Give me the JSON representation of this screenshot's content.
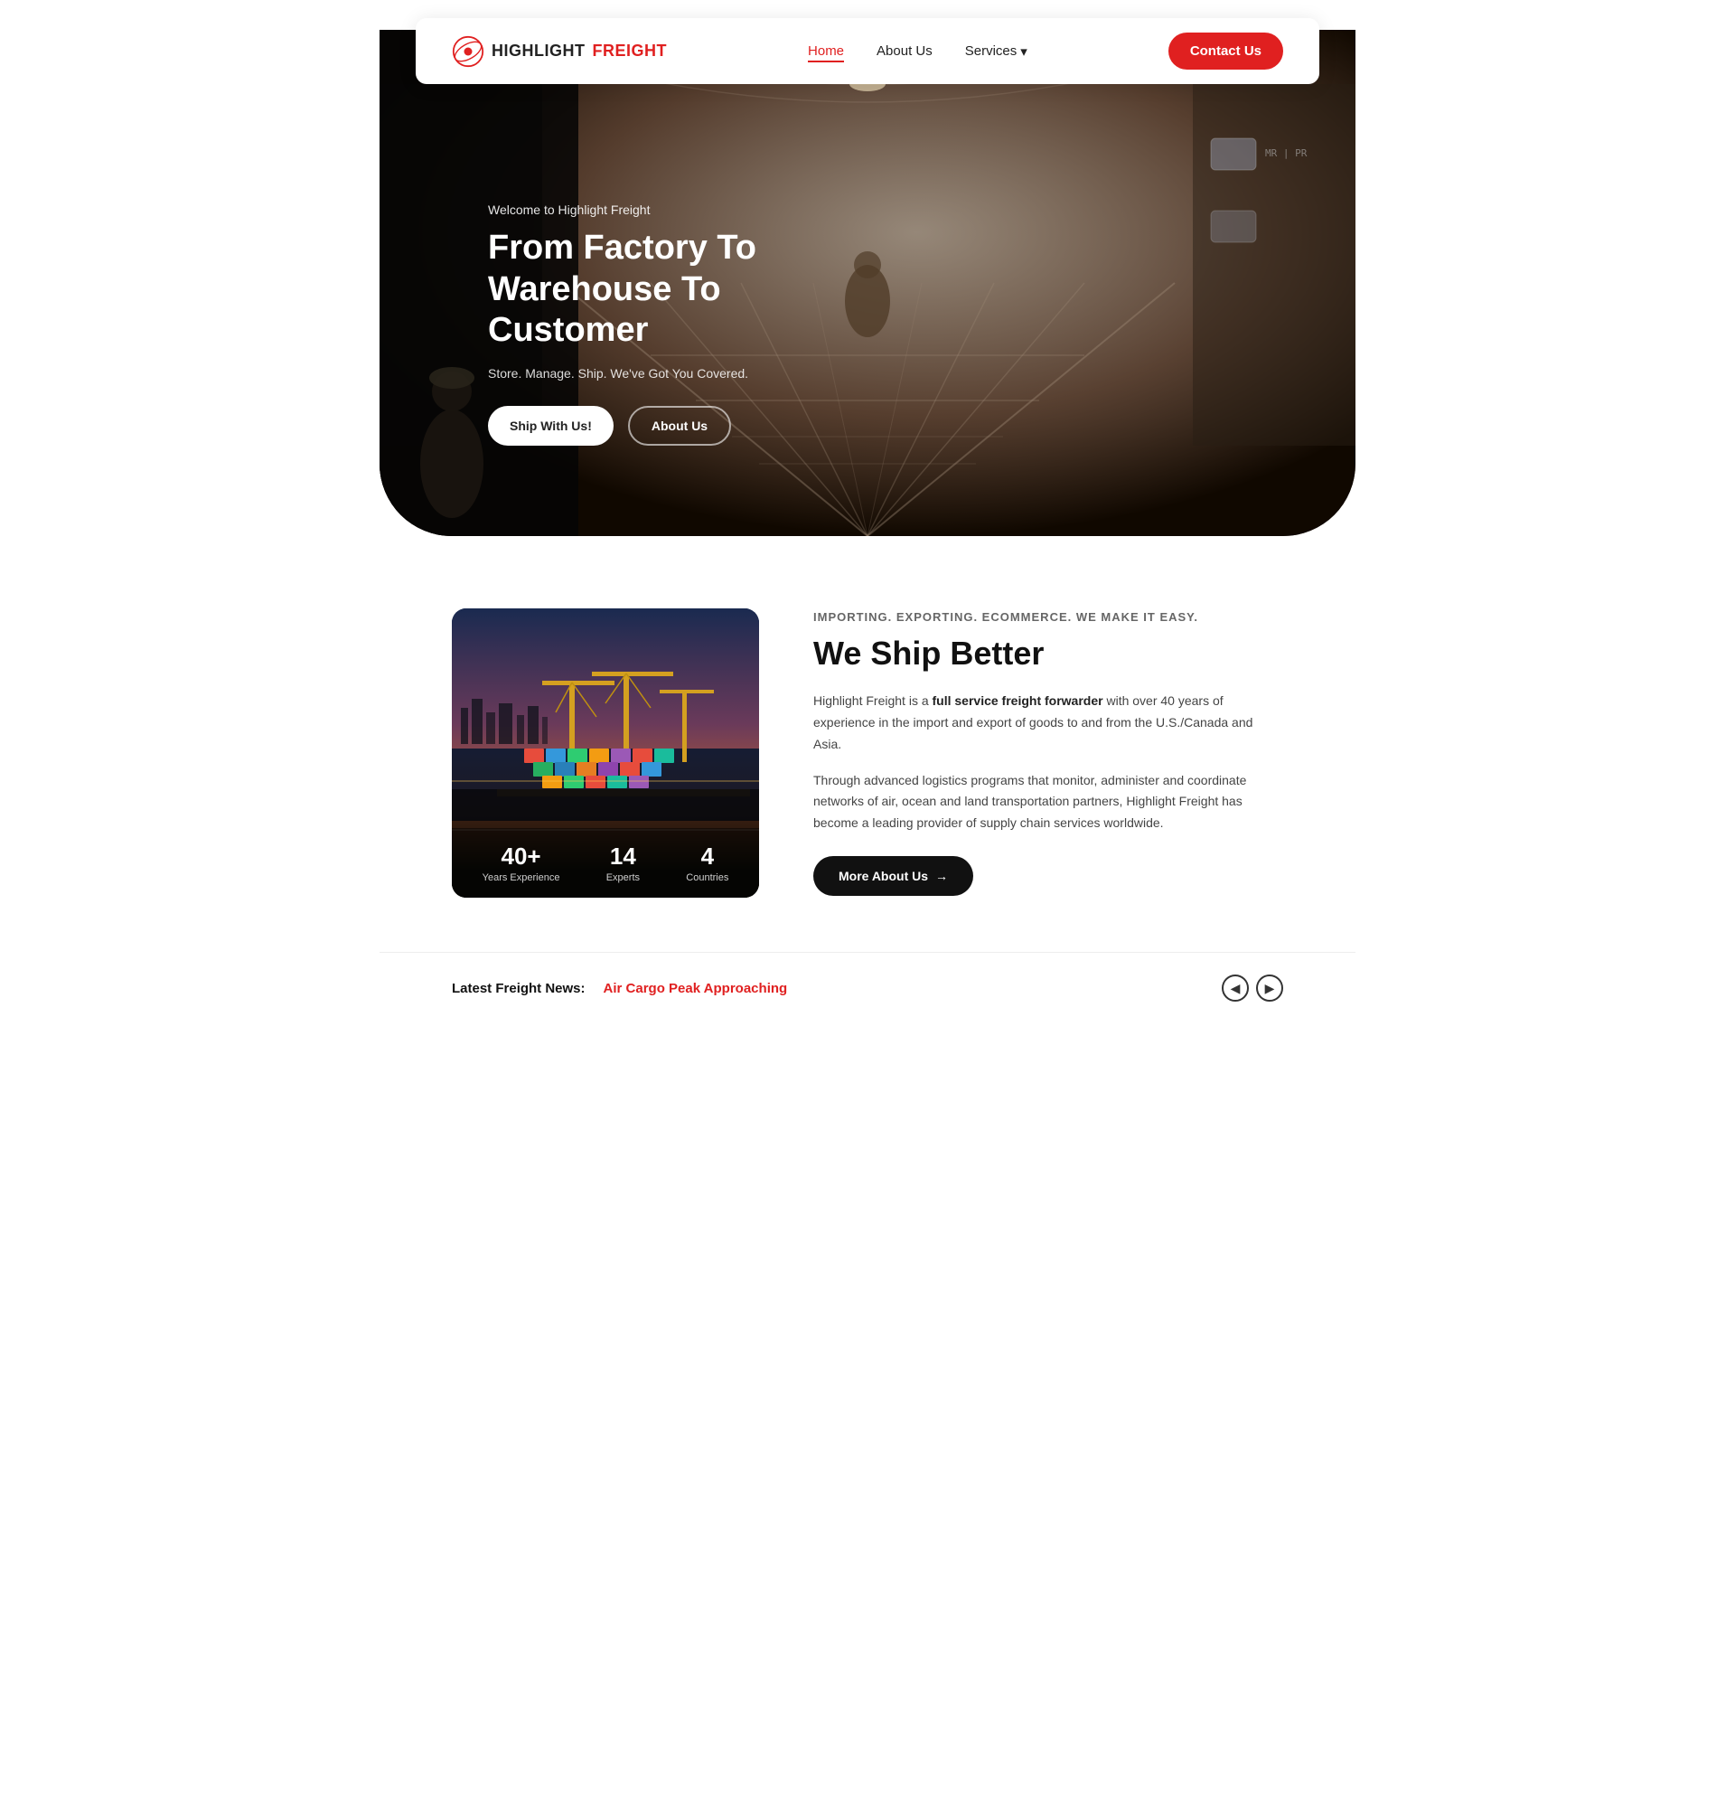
{
  "navbar": {
    "logo_text_highlight": "HIGHLIGHT",
    "logo_text_freight": "FREIGHT",
    "nav_links": [
      {
        "label": "Home",
        "active": true
      },
      {
        "label": "About Us",
        "active": false
      },
      {
        "label": "Services",
        "active": false,
        "has_dropdown": true
      }
    ],
    "contact_button_label": "Contact Us"
  },
  "hero": {
    "welcome_text": "Welcome to Highlight Freight",
    "title": "From Factory To Warehouse To Customer",
    "subtitle": "Store. Manage. Ship. We've Got You Covered.",
    "button_ship": "Ship With Us!",
    "button_about": "About Us"
  },
  "about": {
    "tagline": "IMPORTING. EXPORTING. ECOMMERCE. WE MAKE IT EASY.",
    "heading": "We Ship Better",
    "paragraph1": "Highlight Freight is a full service freight forwarder with over 40 years of experience in the import and export of goods to and from the U.S./Canada and Asia.",
    "paragraph1_bold": "full service freight forwarder",
    "paragraph2": "Through advanced logistics programs that monitor, administer and coordinate networks of air, ocean and land transportation partners, Highlight Freight has become a leading provider of supply chain services worldwide.",
    "more_button_label": "More About Us",
    "stats": [
      {
        "number": "40+",
        "label": "Years Experience"
      },
      {
        "number": "14",
        "label": "Experts"
      },
      {
        "number": "4",
        "label": "Countries"
      }
    ]
  },
  "news": {
    "label": "Latest Freight News:",
    "text": "Air Cargo Peak Approaching"
  },
  "colors": {
    "accent_red": "#e02020",
    "dark": "#111111",
    "text_gray": "#444444"
  },
  "cargo_colors": [
    "#e74c3c",
    "#3498db",
    "#2ecc71",
    "#f39c12",
    "#9b59b6",
    "#1abc9c",
    "#e67e22",
    "#27ae60",
    "#2980b9",
    "#8e44ad",
    "#16a085",
    "#d35400"
  ],
  "icons": {
    "arrow_right": "→",
    "chevron_down": "▾",
    "arrow_left": "◀",
    "arrow_right_btn": "▶"
  }
}
